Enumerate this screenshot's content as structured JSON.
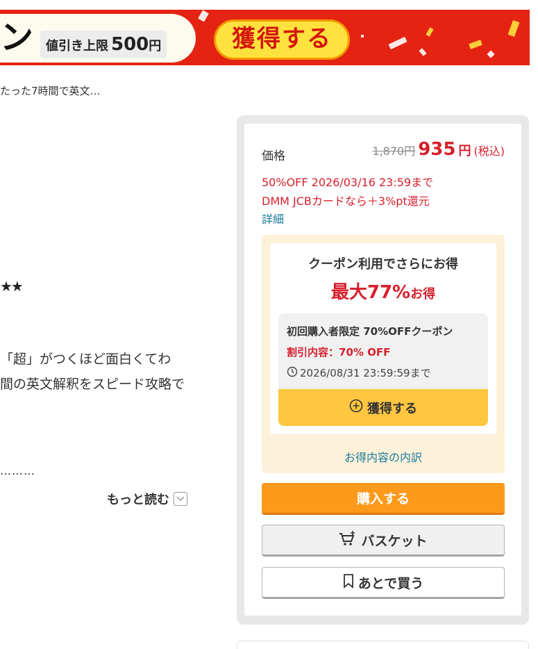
{
  "banner": {
    "title_tail": "ン",
    "limit_label": "値引き上限",
    "limit_amount": "500",
    "limit_unit": "円",
    "cta_label": "獲得する",
    "colors": {
      "background": "#e42313",
      "cta": "#ffe23d"
    }
  },
  "breadcrumb": {
    "text": "たった7時間で英文…"
  },
  "description": {
    "stars": "★★",
    "line1": "「超」がつくほど面白くてわ",
    "line2": "間の英文解釈をスピード攻略で",
    "ellipsis": "………",
    "read_more": "もっと読む"
  },
  "price": {
    "label": "価格",
    "original": "1,870円",
    "current": "935",
    "yen": "円",
    "tax": "(税込)",
    "sale_info": "50%OFF 2026/03/16 23:59まで",
    "card_info": "DMM JCBカードなら＋3%pt還元",
    "detail_link": "詳細"
  },
  "coupon": {
    "heading": "クーポン利用でさらにお得",
    "max_pct": "最大77%",
    "max_suffix": "お得",
    "card": {
      "name": "初回購入者限定 70%OFFクーポン",
      "discount": "割引内容：70% OFF",
      "expiry": "2026/08/31 23:59:59まで",
      "button": "獲得する"
    },
    "breakdown_link": "お得内容の内訳"
  },
  "actions": {
    "buy": "購入する",
    "basket": "バスケット",
    "later": "あとで買う"
  },
  "colors": {
    "accent_red": "#d8202d",
    "buy_orange": "#fd9a1c",
    "coupon_yellow": "#ffc640",
    "link_blue": "#1a7a9c"
  }
}
